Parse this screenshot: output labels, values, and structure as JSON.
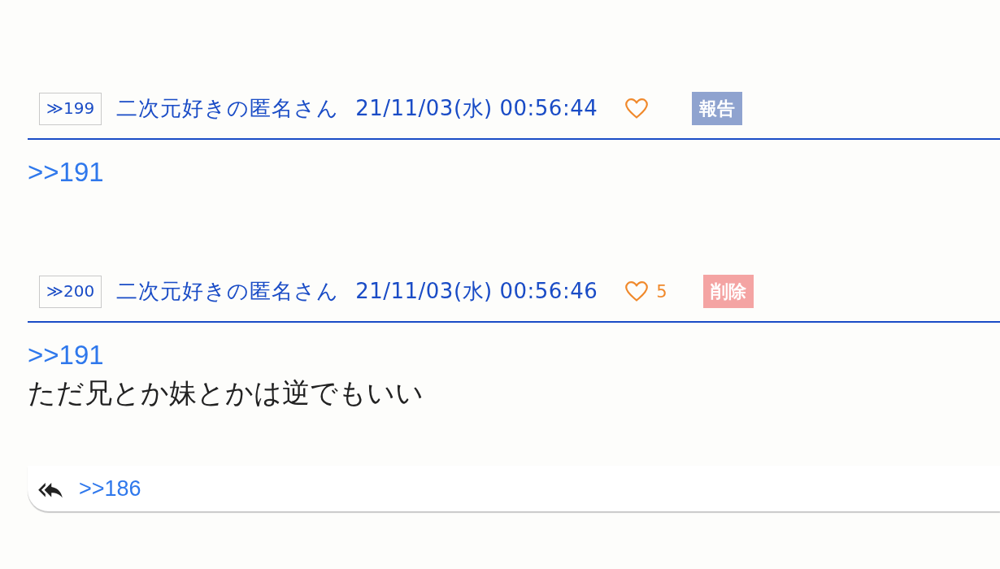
{
  "posts": [
    {
      "number": "≫199",
      "name": "二次元好きの匿名さん",
      "datetime": "21/11/03(水) 00:56:44",
      "action": {
        "kind": "report",
        "label": "報告"
      },
      "body": [
        {
          "kind": "anchor",
          "text": ">>191"
        }
      ]
    },
    {
      "number": "≫200",
      "name": "二次元好きの匿名さん",
      "datetime": "21/11/03(水) 00:56:46",
      "like_count": "5",
      "action": {
        "kind": "delete",
        "label": "削除"
      },
      "body": [
        {
          "kind": "anchor",
          "text": ">>191"
        },
        {
          "kind": "text",
          "text": "ただ兄とか妹とかは逆でもいい"
        }
      ],
      "replies": [
        ">>186"
      ]
    }
  ]
}
